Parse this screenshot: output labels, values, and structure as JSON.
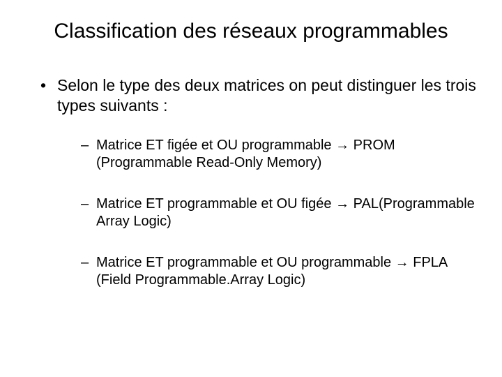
{
  "title": "Classification des réseaux programmables",
  "bullet_intro": "Selon le type des deux matrices on peut distinguer les trois types suivants :",
  "arrow": "→",
  "items": [
    {
      "text_before": "Matrice ET figée et OU programmable ",
      "text_after": " PROM (Programmable Read-Only Memory)"
    },
    {
      "text_before": "Matrice ET programmable et OU figée ",
      "text_after": " PAL(Programmable Array Logic)"
    },
    {
      "text_before": "Matrice ET  programmable et OU programmable ",
      "text_after": " FPLA (Field Programmable.Array Logic)"
    }
  ]
}
